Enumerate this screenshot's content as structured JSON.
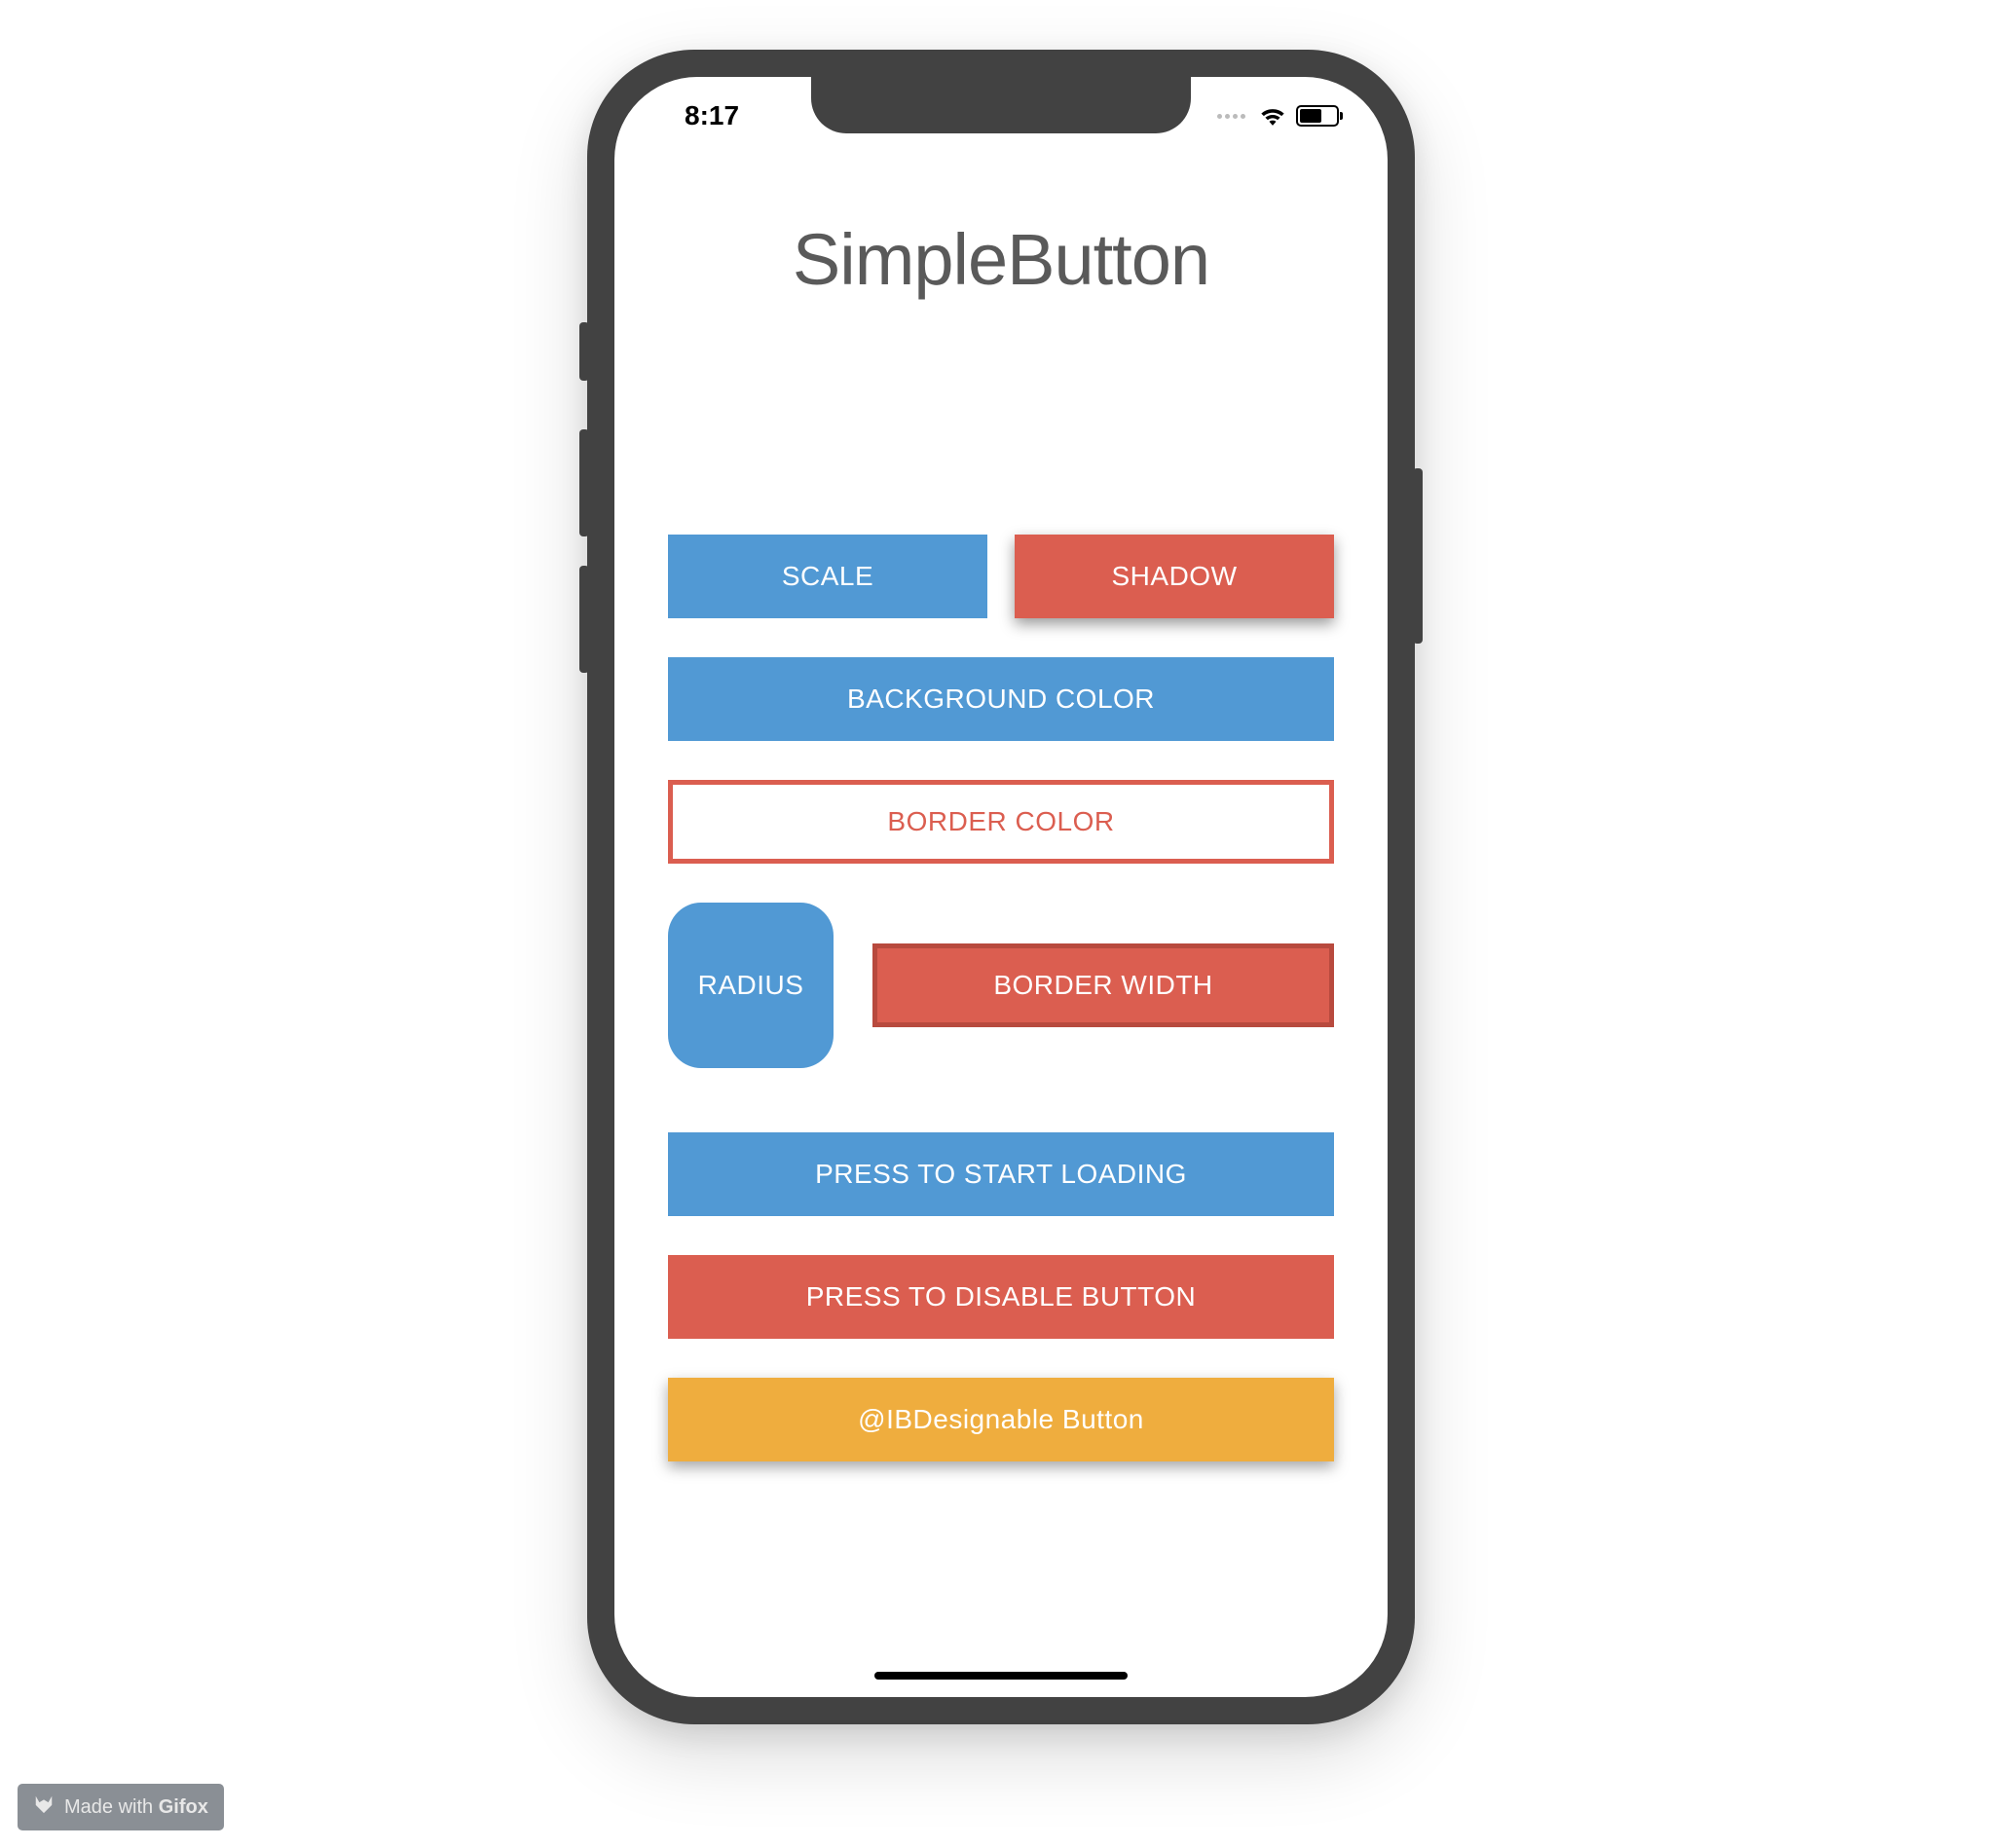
{
  "statusBar": {
    "time": "8:17"
  },
  "app": {
    "title": "SimpleButton"
  },
  "buttons": {
    "scale": "SCALE",
    "shadow": "SHADOW",
    "backgroundColor": "BACKGROUND COLOR",
    "borderColor": "BORDER COLOR",
    "radius": "RADIUS",
    "borderWidth": "BORDER WIDTH",
    "startLoading": "PRESS TO START LOADING",
    "disableButton": "PRESS TO DISABLE BUTTON",
    "ibdesignable": "@IBDesignable Button"
  },
  "watermark": {
    "prefix": "Made with ",
    "brand": "Gifox"
  },
  "colors": {
    "blue": "#5199D4",
    "red": "#DB5E50",
    "redBorder": "#B84A3E",
    "yellow": "#EFAD3E",
    "frame": "#424242",
    "titleGray": "#5a5a5a"
  }
}
